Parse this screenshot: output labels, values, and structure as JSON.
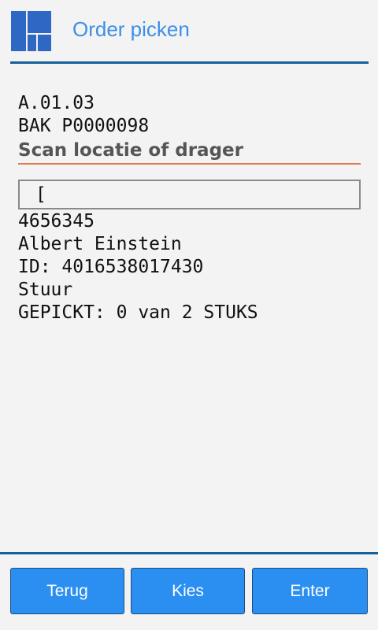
{
  "header": {
    "title": "Order picken",
    "logo_icon": "app-logo-icon",
    "accent_color": "#3d8fe6",
    "rule_color": "#14609a"
  },
  "pick": {
    "location": "A.01.03",
    "container": "BAK P0000098",
    "prompt": "Scan locatie of drager",
    "scan_value": "[",
    "article_number": "4656345",
    "customer_name": "Albert Einstein",
    "id_line": "ID: 4016538017430",
    "description": "Stuur",
    "picked_status": "GEPICKT: 0 van 2 STUKS"
  },
  "footer": {
    "buttons": [
      {
        "label": "Terug"
      },
      {
        "label": "Kies"
      },
      {
        "label": "Enter"
      }
    ],
    "button_color": "#2a8ff0"
  }
}
